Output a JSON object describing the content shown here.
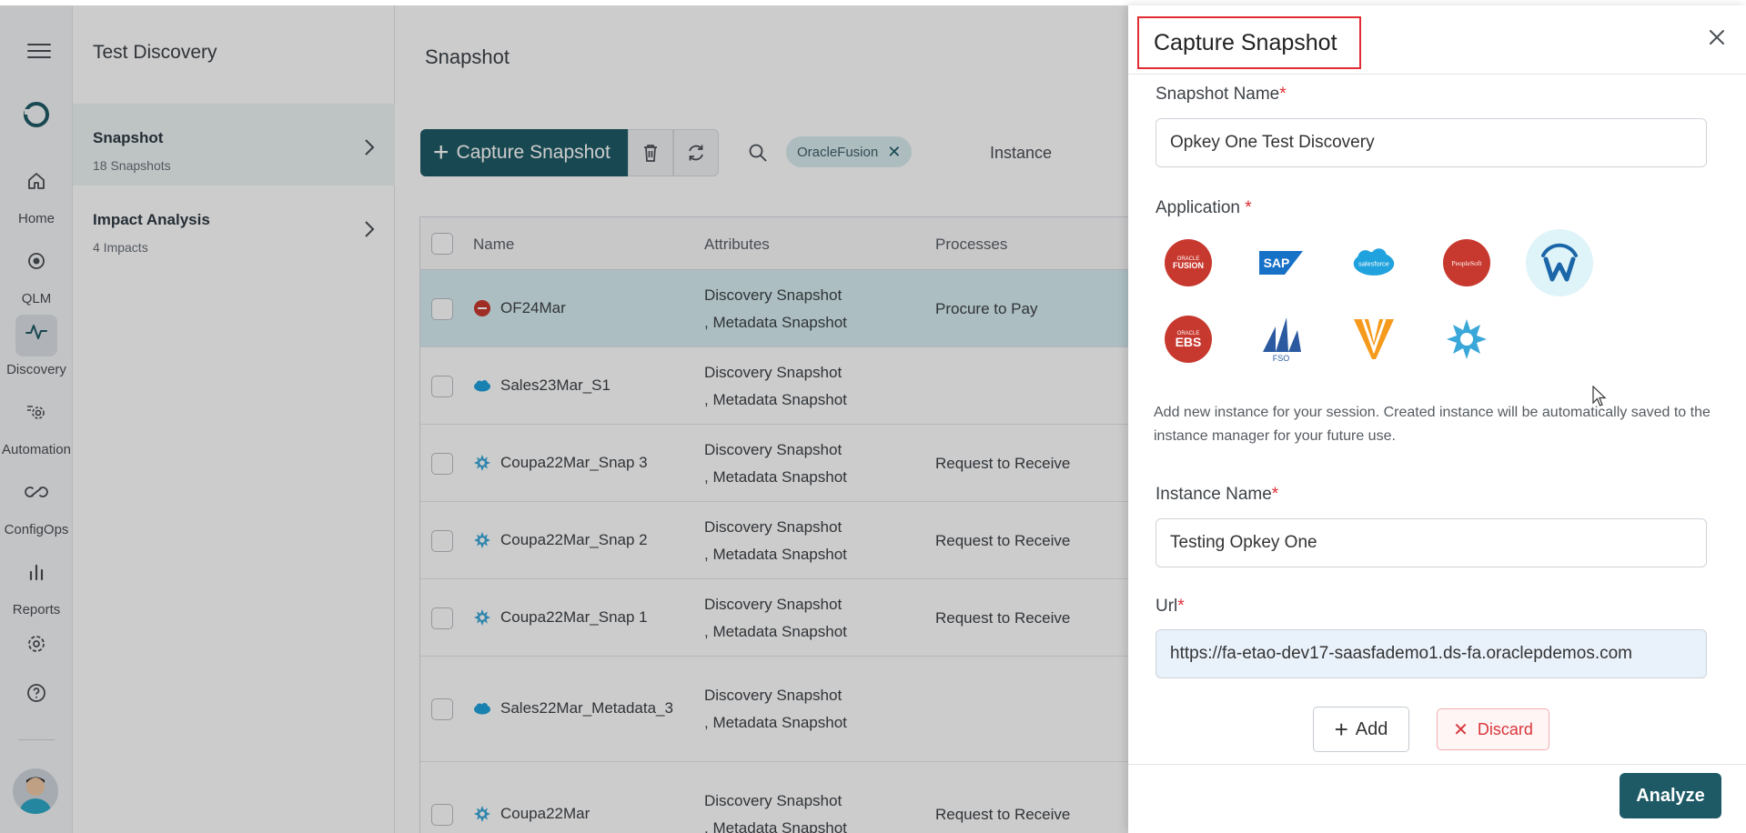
{
  "rail": {
    "items": [
      {
        "label": "Home",
        "icon": "home-icon"
      },
      {
        "label": "QLM",
        "icon": "qlm-icon"
      },
      {
        "label": "Discovery",
        "icon": "pulse-icon"
      },
      {
        "label": "Automation",
        "icon": "automation-icon"
      },
      {
        "label": "ConfigOps",
        "icon": "configops-icon"
      },
      {
        "label": "Reports",
        "icon": "bar-chart-icon"
      }
    ]
  },
  "side": {
    "title": "Test Discovery",
    "items": [
      {
        "label": "Snapshot",
        "sub": "18 Snapshots"
      },
      {
        "label": "Impact Analysis",
        "sub": "4 Impacts"
      }
    ]
  },
  "main": {
    "title": "Snapshot",
    "capture_label": "Capture Snapshot",
    "filter_chip": "OracleFusion",
    "instance_label": "Instance",
    "columns": {
      "name": "Name",
      "attributes": "Attributes",
      "processes": "Processes"
    },
    "rows": [
      {
        "name": "OF24Mar",
        "app": "oracle",
        "attr1": "Discovery Snapshot",
        "attr2": ", Metadata Snapshot",
        "process": "Procure to Pay"
      },
      {
        "name": "Sales23Mar_S1",
        "app": "salesforce",
        "attr1": "Discovery Snapshot",
        "attr2": ", Metadata Snapshot",
        "process": ""
      },
      {
        "name": "Coupa22Mar_Snap 3",
        "app": "coupa",
        "attr1": "Discovery Snapshot",
        "attr2": ", Metadata Snapshot",
        "process": "Request to Receive"
      },
      {
        "name": "Coupa22Mar_Snap 2",
        "app": "coupa",
        "attr1": "Discovery Snapshot",
        "attr2": ", Metadata Snapshot",
        "process": "Request to Receive"
      },
      {
        "name": "Coupa22Mar_Snap 1",
        "app": "coupa",
        "attr1": "Discovery Snapshot",
        "attr2": ", Metadata Snapshot",
        "process": "Request to Receive"
      },
      {
        "name": "Sales22Mar_Metadata_3",
        "app": "salesforce",
        "attr1": "Discovery Snapshot",
        "attr2": ", Metadata Snapshot",
        "process": ""
      },
      {
        "name": "Coupa22Mar",
        "app": "coupa",
        "attr1": "Discovery Snapshot",
        "attr2": ", Metadata Snapshot",
        "process": "Request to Receive"
      }
    ]
  },
  "drawer": {
    "title": "Capture Snapshot",
    "snapshot_name_label": "Snapshot Name",
    "snapshot_name_value": "Opkey One Test Discovery",
    "application_label": "Application",
    "apps": {
      "fusion_top": "ORACLE",
      "fusion": "FUSION",
      "sap": "SAP",
      "salesforce": "salesforce",
      "peoplesoft": "PeopleSoft",
      "ebs_top": "ORACLE",
      "ebs": "EBS",
      "fso": "FSO"
    },
    "hint": "Add new instance for your session. Created instance will be automatically saved to the instance manager for your future use.",
    "instance_name_label": "Instance Name",
    "instance_name_value": "Testing Opkey One",
    "url_label": "Url",
    "url_value": "https://fa-etao-dev17-saasfademo1.ds-fa.oraclepdemos.com",
    "add_label": "Add",
    "discard_label": "Discard",
    "analyze_label": "Analyze",
    "required_mark": "*"
  },
  "colors": {
    "primary": "#1e5a66",
    "danger": "#e02c32",
    "selected_row": "#d8eef2"
  }
}
